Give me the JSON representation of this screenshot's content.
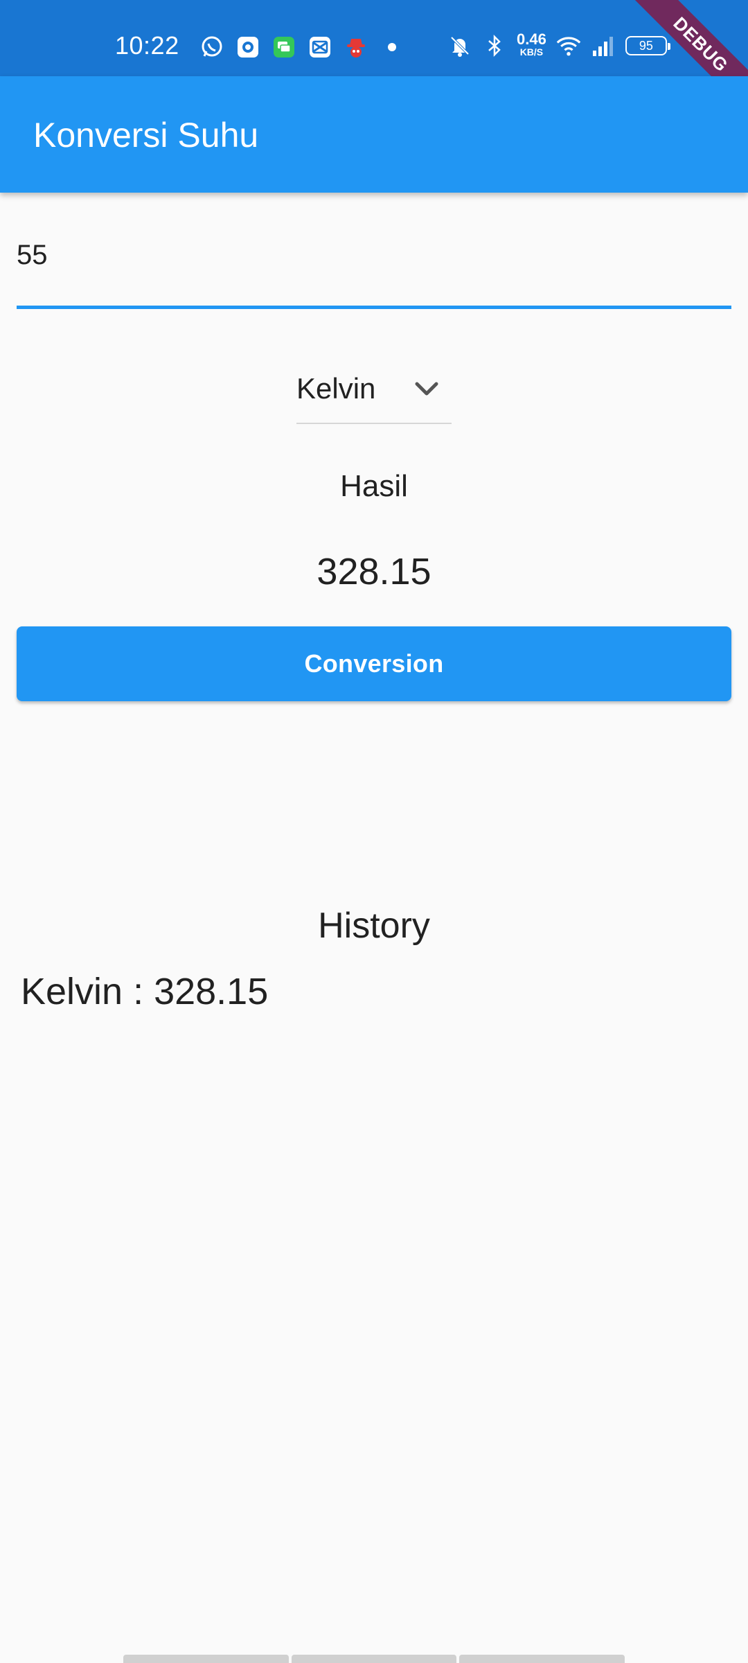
{
  "status_bar": {
    "time": "10:22",
    "net_speed_value": "0.46",
    "net_speed_unit": "KB/S",
    "battery": "95",
    "icons_left": [
      "whatsapp-icon",
      "camera-app-icon",
      "chat-app-icon",
      "capcut-icon",
      "spy-app-icon",
      "dot-icon"
    ],
    "icons_right": [
      "mute-bell-icon",
      "bluetooth-icon",
      "wifi-icon",
      "signal-icon",
      "battery-icon"
    ]
  },
  "debug_banner": "DEBUG",
  "app_bar": {
    "title": "Konversi Suhu"
  },
  "input": {
    "value": "55"
  },
  "dropdown": {
    "selected": "Kelvin"
  },
  "result": {
    "label": "Hasil",
    "value": "328.15"
  },
  "convert_button": {
    "label": "Conversion"
  },
  "history": {
    "title": "History",
    "items": [
      "Kelvin : 328.15"
    ]
  },
  "colors": {
    "status_bar": "#1976d2",
    "primary": "#2196f3",
    "background": "#fafafa",
    "text": "#212121"
  }
}
